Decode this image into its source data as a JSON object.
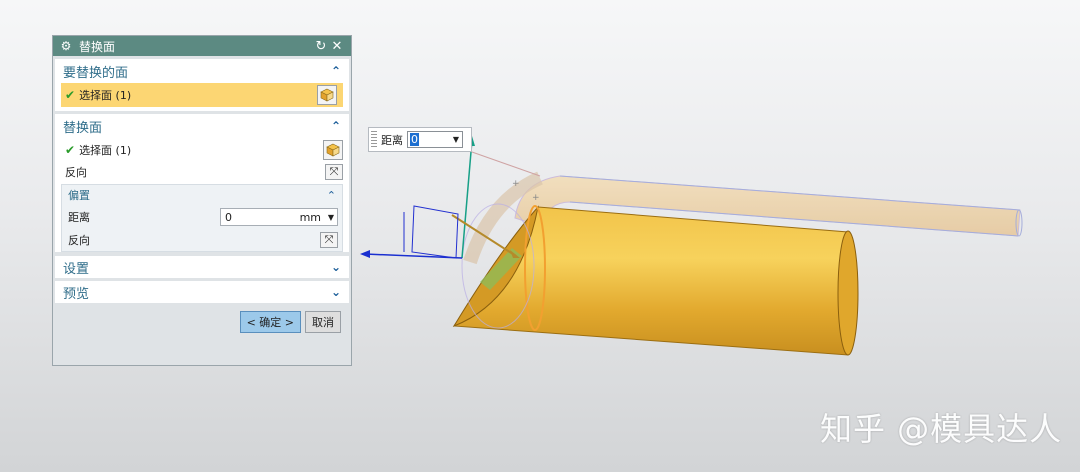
{
  "dialog": {
    "title": "替换面",
    "icons": {
      "title_icon": "gear-icon",
      "reset": "reset-icon",
      "close": "close-icon"
    },
    "face_to_replace": {
      "header": "要替换的面",
      "select_label": "选择面 (1)"
    },
    "replacement_face": {
      "header": "替换面",
      "select_label": "选择面 (1)",
      "reverse_label": "反向",
      "offset": {
        "header": "偏置",
        "distance_label": "距离",
        "distance_value": "0",
        "distance_unit": "mm",
        "reverse_label": "反向"
      }
    },
    "settings_label": "设置",
    "preview_label": "预览",
    "ok_label": "< 确定 >",
    "cancel_label": "取消"
  },
  "distance_popup": {
    "label": "距离",
    "value": "0"
  },
  "watermark": "知乎 @模具达人",
  "colors": {
    "titlebar": "#5c8a82",
    "selected_row": "#fcd673",
    "ok_button": "#9cc9ea",
    "part_gold": "#e9b43a"
  }
}
